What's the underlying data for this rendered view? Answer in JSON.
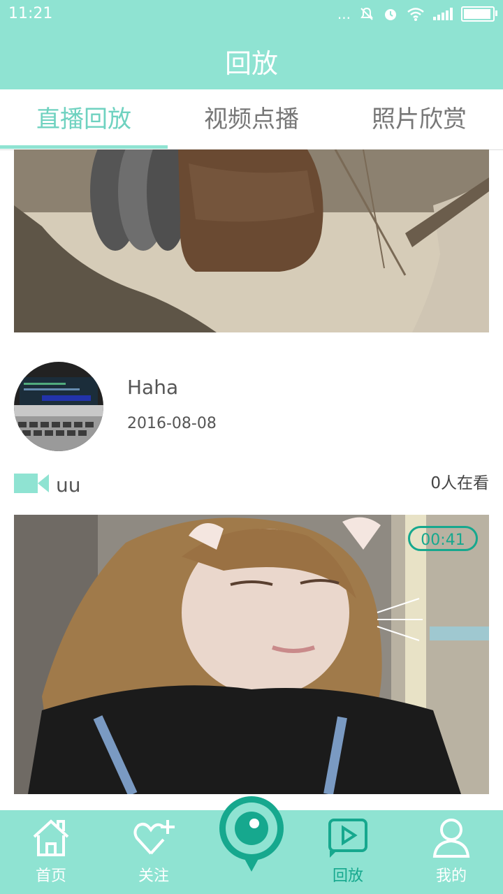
{
  "status": {
    "time": "11:21",
    "dots": "...",
    "battery_level": 0.95
  },
  "header": {
    "title": "回放"
  },
  "tabs": [
    {
      "label": "直播回放",
      "active": true
    },
    {
      "label": "视频点播",
      "active": false
    },
    {
      "label": "照片欣赏",
      "active": false
    }
  ],
  "feed": {
    "author": {
      "name": "Haha",
      "date": "2016-08-08"
    },
    "live": {
      "user": "uu",
      "watching": "0人在看",
      "duration": "00:41"
    }
  },
  "bottom_nav": [
    {
      "label": "首页",
      "icon": "home-icon",
      "active": false
    },
    {
      "label": "关注",
      "icon": "heart-plus-icon",
      "active": false
    },
    {
      "label": "",
      "icon": "live-camera-icon",
      "active": false
    },
    {
      "label": "回放",
      "icon": "playback-icon",
      "active": true
    },
    {
      "label": "我的",
      "icon": "profile-icon",
      "active": false
    }
  ],
  "colors": {
    "accent": "#8fe3d2",
    "accent_dark": "#16a88e",
    "tab_active": "#6fd2c0"
  }
}
